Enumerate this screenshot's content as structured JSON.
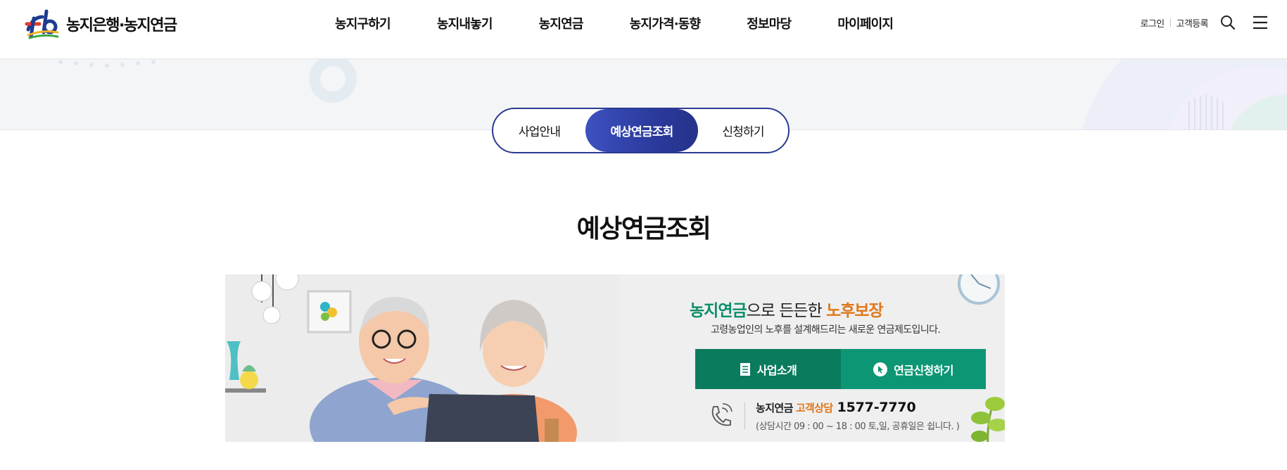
{
  "header": {
    "logo_text": "농지은행·농지연금",
    "nav": [
      "농지구하기",
      "농지내놓기",
      "농지연금",
      "농지가격·동향",
      "정보마당",
      "마이페이지"
    ],
    "util": {
      "login": "로그인",
      "register": "고객등록"
    },
    "icons": {
      "search": "search-icon",
      "menu": "hamburger-menu-icon"
    }
  },
  "tabs": {
    "items": [
      "사업안내",
      "예상연금조회",
      "신청하기"
    ],
    "active_index": 1
  },
  "page_title": "예상연금조회",
  "banner": {
    "title_part1": "농지연금",
    "title_part2": "으로 든든한 ",
    "title_part3": "노후보장",
    "subtitle": "고령농업인의 노후를 설계해드리는 새로운 연금제도입니다.",
    "btn_intro": "사업소개",
    "btn_apply": "연금신청하기",
    "consult_label": "농지연금",
    "consult_accent": "고객상담",
    "phone": "1577-7770",
    "hours": "(상담시간 09 : 00 ~ 18 : 00 토,일, 공휴일은 쉽니다. )"
  },
  "colors": {
    "brand_navy": "#2b3a8f",
    "green": "#0b7b5e",
    "green_light": "#0d9673",
    "orange": "#e0771b"
  }
}
